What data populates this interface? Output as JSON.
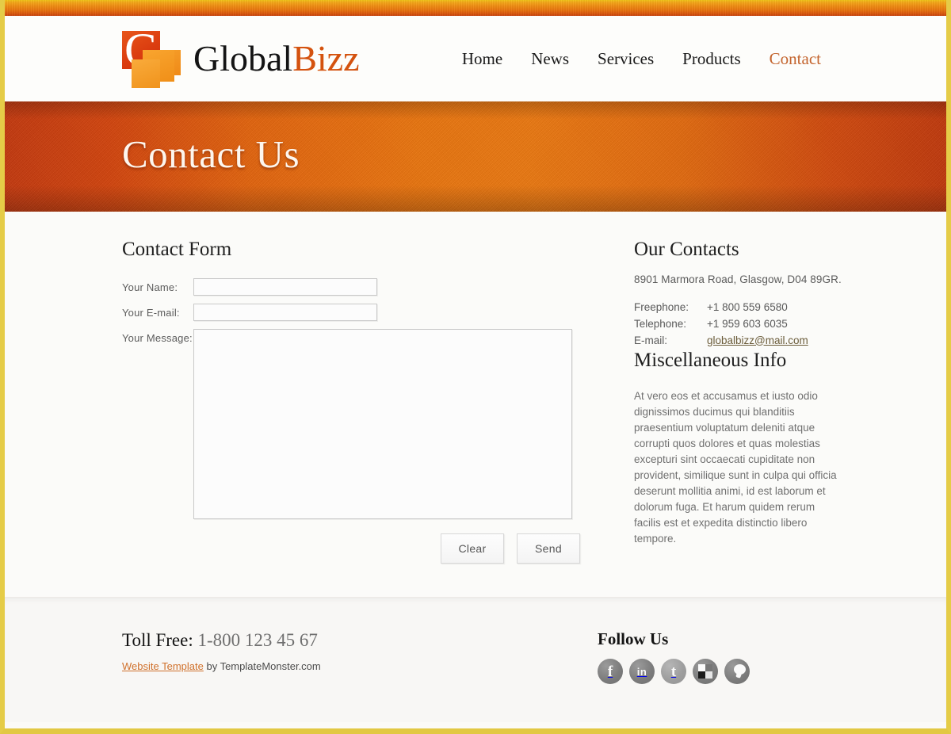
{
  "brand": {
    "name_part_a": "Global",
    "name_part_b": "Bizz",
    "logo_letter": "G"
  },
  "nav": {
    "items": [
      {
        "label": "Home",
        "active": false
      },
      {
        "label": "News",
        "active": false
      },
      {
        "label": "Services",
        "active": false
      },
      {
        "label": "Products",
        "active": false
      },
      {
        "label": "Contact",
        "active": true
      }
    ]
  },
  "banner": {
    "title": "Contact Us"
  },
  "form": {
    "title": "Contact Form",
    "fields": {
      "name_label": "Your Name:",
      "name_value": "",
      "email_label": "Your E-mail:",
      "email_value": "",
      "message_label": "Your Message:",
      "message_value": ""
    },
    "clear_label": "Clear",
    "send_label": "Send"
  },
  "contacts": {
    "title": "Our Contacts",
    "address": "8901 Marmora Road, Glasgow, D04 89GR.",
    "rows": [
      {
        "label": "Freephone:",
        "value": "+1 800 559 6580",
        "is_link": false
      },
      {
        "label": "Telephone:",
        "value": "+1 959 603 6035",
        "is_link": false
      },
      {
        "label": "E-mail:",
        "value": "globalbizz@mail.com",
        "is_link": true
      }
    ]
  },
  "misc": {
    "title": "Miscellaneous Info",
    "body": "At vero eos et accusamus et iusto odio dignissimos ducimus qui blanditiis praesentium voluptatum deleniti atque corrupti quos dolores et quas molestias excepturi sint occaecati cupiditate non provident, similique sunt in culpa qui officia deserunt mollitia animi, id est laborum et dolorum fuga. Et harum quidem rerum facilis est et expedita distinctio libero tempore."
  },
  "footer": {
    "toll_label": "Toll Free:",
    "toll_number": "1-800 123 45 67",
    "credit_link": "Website Template",
    "credit_rest": " by TemplateMonster.com",
    "follow_title": "Follow Us",
    "social": [
      {
        "name": "facebook",
        "glyph": "f"
      },
      {
        "name": "linkedin",
        "glyph": "in"
      },
      {
        "name": "twitter",
        "glyph": "t"
      },
      {
        "name": "delicious",
        "glyph": ""
      },
      {
        "name": "messenger",
        "glyph": ""
      }
    ]
  },
  "colors": {
    "accent_orange": "#e8740f",
    "deep_red": "#c33a10",
    "border_yellow": "#e5cc47",
    "link_orange": "#d0712c",
    "nav_active": "#c4652f"
  }
}
